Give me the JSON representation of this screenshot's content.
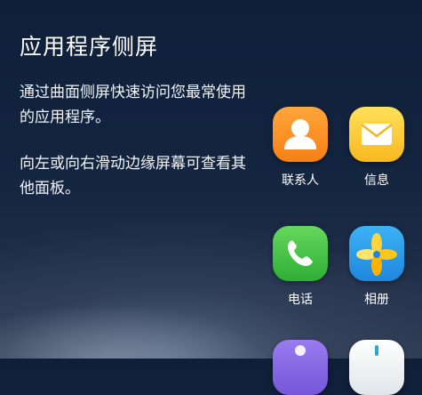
{
  "intro": {
    "title": "应用程序侧屏",
    "paragraph1": "通过曲面侧屏快速访问您最常使用的应用程序。",
    "paragraph2": "向左或向右滑动边缘屏幕可查看其他面板。"
  },
  "edge_panel": {
    "apps": [
      {
        "label": "联系人",
        "icon": "contacts-icon",
        "color": "#F57F17"
      },
      {
        "label": "信息",
        "icon": "messages-icon",
        "color": "#F9B81E"
      },
      {
        "label": "电话",
        "icon": "phone-icon",
        "color": "#2FAE35"
      },
      {
        "label": "相册",
        "icon": "gallery-icon",
        "color": "#1F86DC"
      },
      {
        "label": "",
        "icon": "purple-app-icon",
        "color": "#7456D8"
      },
      {
        "label": "",
        "icon": "white-app-icon",
        "color": "#FFFFFF"
      }
    ]
  }
}
